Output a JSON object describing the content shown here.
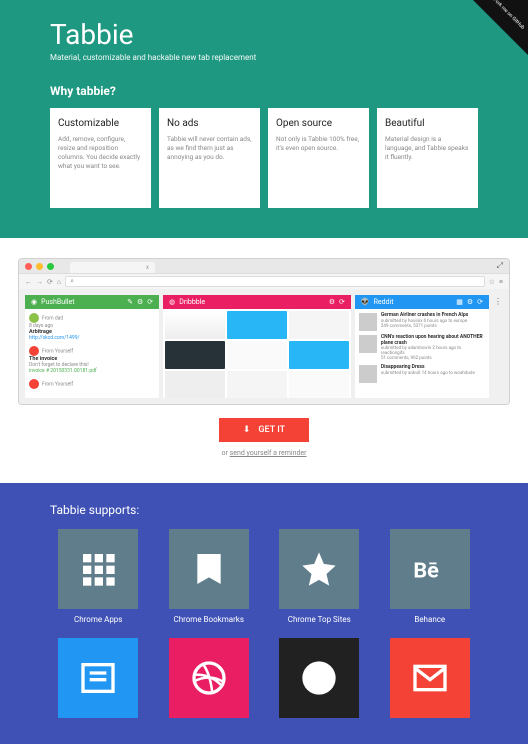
{
  "ribbon": "Fork me on GitHub",
  "hero": {
    "brand": "Tabbie",
    "tagline": "Material, customizable and hackable new tab replacement",
    "why": "Why tabbie?",
    "cards": [
      {
        "title": "Customizable",
        "body": "Add, remove, configure, resize and reposition columns. You decide exactly what you want to see."
      },
      {
        "title": "No ads",
        "body": "Tabbie will never contain ads, as we find them just as annoying as you do."
      },
      {
        "title": "Open source",
        "body": "Not only is Tabbie 100% free, it's even open source."
      },
      {
        "title": "Beautiful",
        "body": "Material design is a language, and Tabbie speaks it fluently."
      }
    ]
  },
  "browser": {
    "tab_close": "x",
    "search_glyph": "⌕",
    "columns": {
      "pushbullet": {
        "title": "PushBullet",
        "items": [
          {
            "from": "From dad",
            "time": "8 days ago",
            "title": "Arbitrage",
            "link": "http://xkcd.com/1499/"
          },
          {
            "from": "From Yourself",
            "time": "",
            "title": "The invoice",
            "note": "Don't forget to declare this!",
            "sub": "invoice # 20150331.00181.pdf"
          },
          {
            "from": "From Yourself",
            "time": "",
            "title": "",
            "note": "",
            "sub": ""
          }
        ]
      },
      "dribbble": {
        "title": "Dribbble"
      },
      "reddit": {
        "title": "Reddit",
        "items": [
          {
            "title": "German Airliner crashes in French Alps",
            "meta": "submitted by houinix 6 hours ago to europe",
            "stats": "249 comments, 5371 points"
          },
          {
            "title": "CNN's reaction upon hearing about ANOTHER plane crash",
            "meta": "submitted by adamboivin 2 hours ago to reactiongifs",
            "stats": "51 comments, 962 points"
          },
          {
            "title": "Disappearing Dress",
            "meta": "submitted by anbu0 14 hours ago to woahdude",
            "stats": ""
          }
        ]
      }
    }
  },
  "cta": {
    "button": "GET IT",
    "reminder_prefix": "or ",
    "reminder_link": "send yourself a reminder"
  },
  "supports": {
    "title": "Tabbie supports:",
    "items": [
      {
        "label": "Chrome Apps",
        "color": "c-gray",
        "icon": "apps"
      },
      {
        "label": "Chrome Bookmarks",
        "color": "c-gray",
        "icon": "bookmark"
      },
      {
        "label": "Chrome Top Sites",
        "color": "c-gray",
        "icon": "star"
      },
      {
        "label": "Behance",
        "color": "c-gray",
        "icon": "behance"
      },
      {
        "label": "",
        "color": "c-blue",
        "icon": "news"
      },
      {
        "label": "",
        "color": "c-pink",
        "icon": "dribbble"
      },
      {
        "label": "",
        "color": "c-dark",
        "icon": "github"
      },
      {
        "label": "",
        "color": "c-red",
        "icon": "gmail"
      }
    ]
  }
}
